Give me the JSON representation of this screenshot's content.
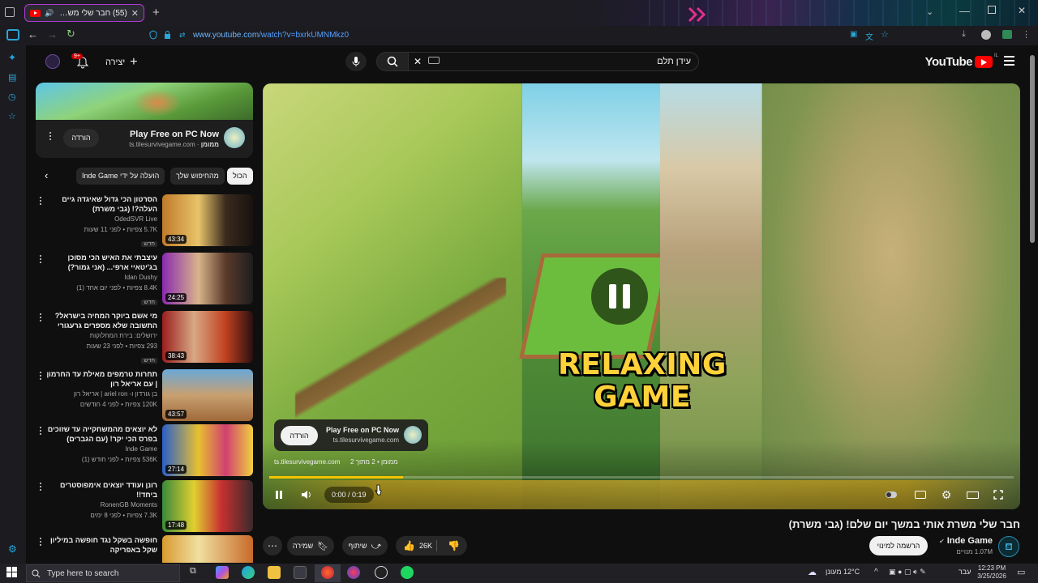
{
  "browser": {
    "tab_title": "(55) חבר שלי משרת אותי ...",
    "url_host": "www.youtube.com",
    "url_path": "/watch?v=bxrkUMNMkz0"
  },
  "header": {
    "logo": "YouTube",
    "logo_sup": "IL",
    "search_value": "עידן תלם",
    "create_label": "יצירה",
    "notification_count": "9+"
  },
  "ad_card": {
    "title": "Play Free on PC Now",
    "sponsored": "ממומן",
    "domain": "ts.tilesurvivegame.com",
    "button": "הורדה"
  },
  "chips": {
    "all": "הכול",
    "from_search": "מהחיפוש שלך",
    "by_uploader": "הועלה על ידי Inde Game"
  },
  "recs": [
    {
      "title": "הסרטון הכי גדול שאיגדה גיים העלה?! (גבי משרת)",
      "channel": "OdedSVR Live",
      "meta": "5.7K צפיות • לפני 11 שעות",
      "badge": "חדש",
      "duration": "43:34"
    },
    {
      "title": "עיצבתי את האיש הכי מסוכן בג'יטאיי ארפי... (אני גמור?)",
      "channel": "Idan Dushy",
      "meta": "8.4K צפיות • לפני יום אחד (1)",
      "badge": "חדש",
      "duration": "24:25"
    },
    {
      "title": "מי אשם ביוקר המחיה בישראל? התשובה שלא מספרים גרעגורי תמר...",
      "channel": "ירושלים: בירת המחלוקות",
      "meta": "293 צפיות • לפני 23 שעות",
      "badge": "חדש",
      "duration": "38:43"
    },
    {
      "title": "תחרות טרמפים מאילת עד החרמון | עם אריאל רון",
      "channel": "בן גורדון ו- ariel ron | אריאל רון",
      "meta": "120K צפיות • לפני 4 חודשים",
      "badge": "",
      "duration": "43:57"
    },
    {
      "title": "לא יוצאים מהמשחקייה עד שזוכים בפרס הכי יקר! (עם הגברים)",
      "channel": "Inde Game",
      "meta": "536K צפיות • לפני חודש (1)",
      "badge": "",
      "duration": "27:14"
    },
    {
      "title": "רונן ועודד יוצאים אימפוסטרים ביחד!!",
      "channel": "RonenGB Moments",
      "meta": "7.3K צפיות • לפני 8 ימים",
      "badge": "",
      "duration": "17:48"
    },
    {
      "title": "חופשה בשקל נגד חופשה במיליון שקל באפריקה",
      "channel": "",
      "meta": "",
      "badge": "",
      "duration": ""
    }
  ],
  "player": {
    "overlay_text_1": "RELAXING",
    "overlay_text_2": "GAME",
    "overlay_ad_title": "Play Free on PC Now",
    "overlay_ad_domain": "ts.tilesurvivegame.com",
    "overlay_ad_button": "הורדה",
    "ad_source": "ts.tilesurvivegame.com",
    "ad_info": "ממומן • 2 מתוך 2",
    "time": "0:00 / 0:19",
    "progress": 0.18
  },
  "video": {
    "title": "חבר שלי משרת אותי במשך יום שלם! (גבי משרת)",
    "channel": "Inde Game",
    "subscribers": "1.07M מנויים",
    "subscribe_label": "הרשמה למינוי",
    "likes": "26K",
    "share_label": "שיתוף",
    "save_label": "שמירה"
  },
  "taskbar": {
    "search_placeholder": "Type here to search",
    "weather": "12°C מעונן",
    "lang": "עבר",
    "time": "12:23 PM",
    "date": "3/25/2026"
  },
  "colors": {
    "accent": "#ff0000",
    "progress": "#f2c500",
    "link": "#54a0ff",
    "tab_border": "#b13ad6"
  }
}
